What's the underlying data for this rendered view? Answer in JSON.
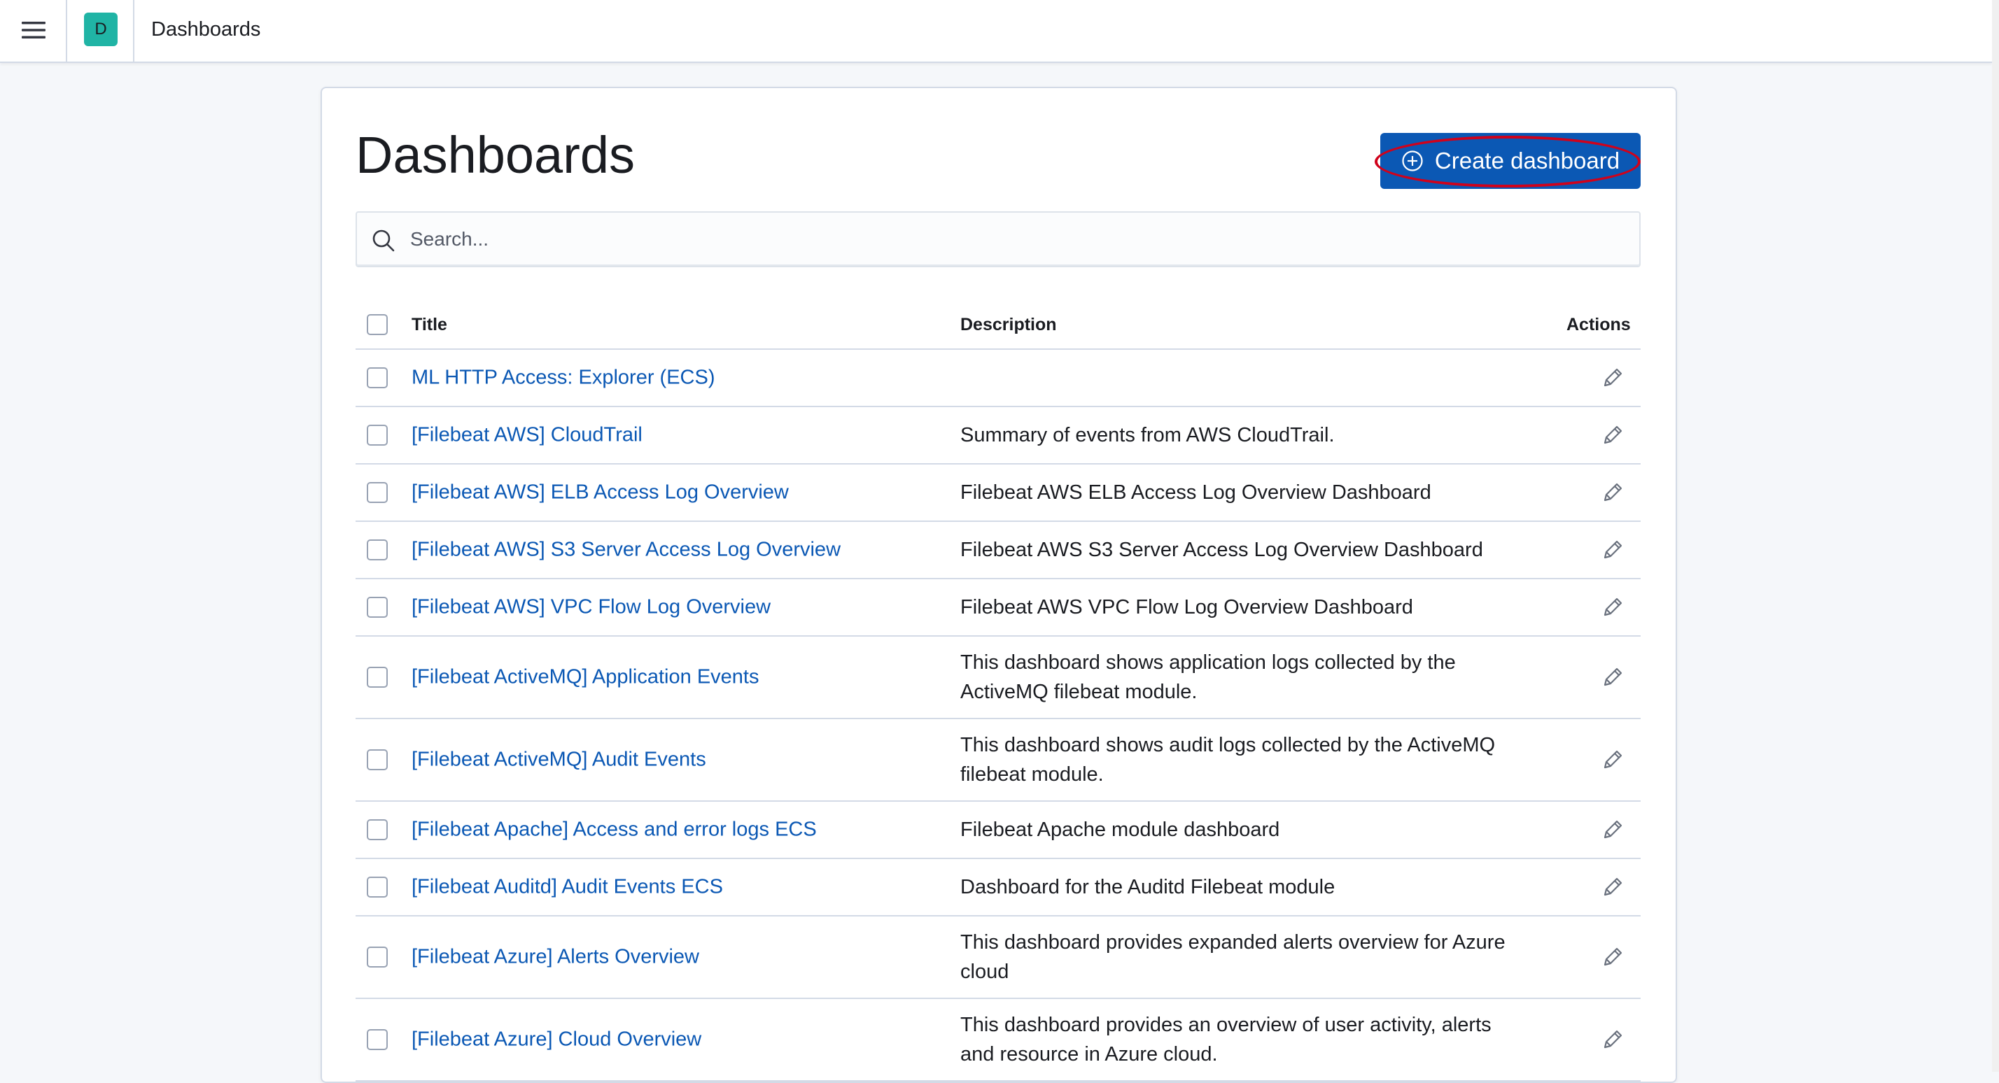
{
  "header": {
    "menu_icon": "hamburger-menu-icon",
    "space_avatar_letter": "D",
    "breadcrumb": "Dashboards"
  },
  "page": {
    "title": "Dashboards",
    "create_button_label": "Create dashboard",
    "create_button_icon": "plus-circle-icon",
    "accent_color": "#0b58b4"
  },
  "search": {
    "placeholder": "Search...",
    "value": ""
  },
  "table": {
    "columns": {
      "title": "Title",
      "description": "Description",
      "actions": "Actions"
    },
    "rows": [
      {
        "title": "ML HTTP Access: Explorer (ECS)",
        "description": ""
      },
      {
        "title": "[Filebeat AWS] CloudTrail",
        "description": "Summary of events from AWS CloudTrail."
      },
      {
        "title": "[Filebeat AWS] ELB Access Log Overview",
        "description": "Filebeat AWS ELB Access Log Overview Dashboard"
      },
      {
        "title": "[Filebeat AWS] S3 Server Access Log Overview",
        "description": "Filebeat AWS S3 Server Access Log Overview Dashboard"
      },
      {
        "title": "[Filebeat AWS] VPC Flow Log Overview",
        "description": "Filebeat AWS VPC Flow Log Overview Dashboard"
      },
      {
        "title": "[Filebeat ActiveMQ] Application Events",
        "description": "This dashboard shows application logs collected by the ActiveMQ filebeat module."
      },
      {
        "title": "[Filebeat ActiveMQ] Audit Events",
        "description": "This dashboard shows audit logs collected by the ActiveMQ filebeat module."
      },
      {
        "title": "[Filebeat Apache] Access and error logs ECS",
        "description": "Filebeat Apache module dashboard"
      },
      {
        "title": "[Filebeat Auditd] Audit Events ECS",
        "description": "Dashboard for the Auditd Filebeat module"
      },
      {
        "title": "[Filebeat Azure] Alerts Overview",
        "description": "This dashboard provides expanded alerts overview for Azure cloud"
      },
      {
        "title": "[Filebeat Azure] Cloud Overview",
        "description": "This dashboard provides an overview of user activity, alerts and resource in Azure cloud."
      }
    ],
    "row_action_icon": "pencil-edit-icon"
  }
}
